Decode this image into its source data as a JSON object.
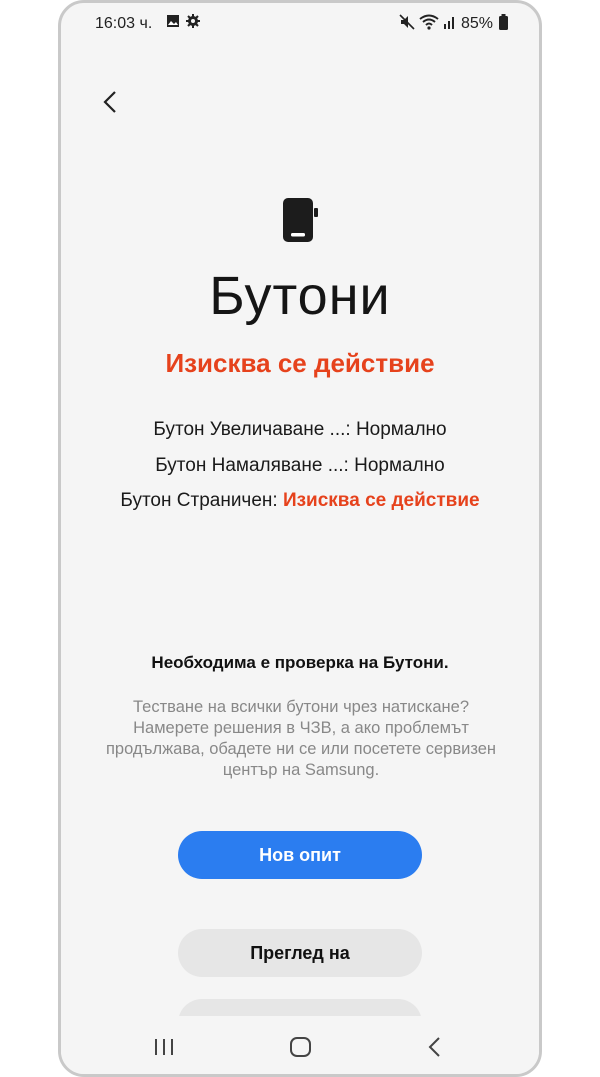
{
  "status_bar": {
    "time": "16:03 ч.",
    "battery": "85%",
    "icons": [
      "image-icon",
      "gear-icon",
      "mute-icon",
      "wifi-icon",
      "signal-icon",
      "battery-icon"
    ]
  },
  "title": "Бутони",
  "action_status": "Изисква се действие",
  "results": [
    {
      "label": "Бутон Увеличаване ...:",
      "value": "Нормално"
    },
    {
      "label": "Бутон Намаляване ...:",
      "value": "Нормално"
    },
    {
      "label": "Бутон Страничен:",
      "value": "Изисква се действие"
    }
  ],
  "heading": "Необходима е проверка на Бутони.",
  "description": "Тестване на всички бутони чрез натискане? Намерете решения в ЧЗВ, а ако проблемът продължава, обадете ни се или посетете сервизен център на Samsung.",
  "buttons": {
    "retry": "Нов опит",
    "review": "Преглед на"
  },
  "colors": {
    "accent_red": "#e6421c",
    "primary_blue": "#2b7df0",
    "background": "#f5f5f5"
  }
}
